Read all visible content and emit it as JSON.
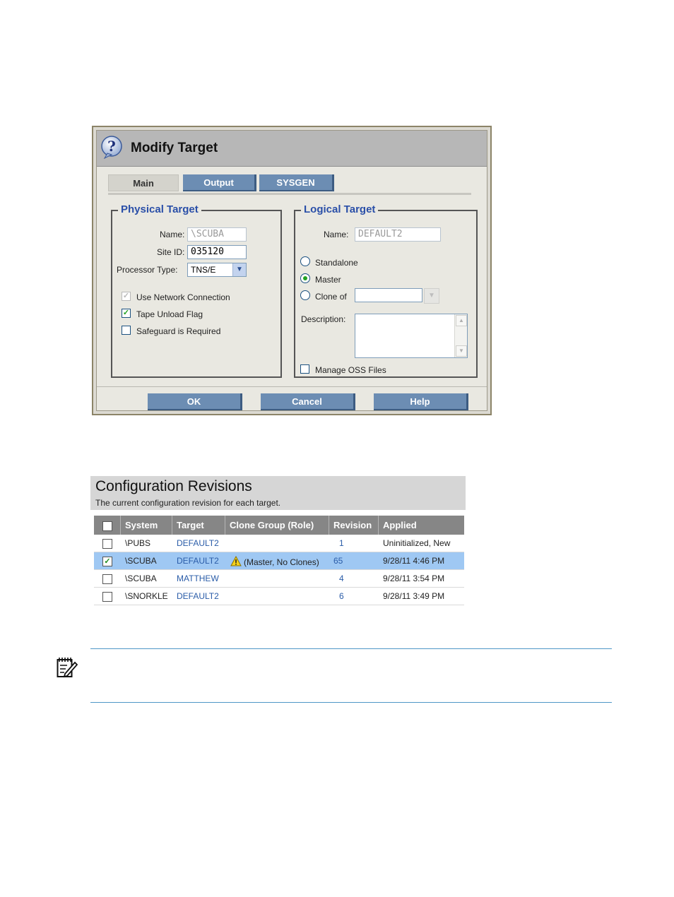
{
  "dialog": {
    "title": "Modify Target",
    "tabs": [
      {
        "label": "Main",
        "active": true
      },
      {
        "label": "Output",
        "active": false
      },
      {
        "label": "SYSGEN",
        "active": false
      }
    ],
    "physical": {
      "legend": "Physical Target",
      "name_label": "Name:",
      "name_value": "\\SCUBA",
      "site_label": "Site ID:",
      "site_value": "035120",
      "proc_label": "Processor Type:",
      "proc_value": "TNS/E",
      "checks": [
        {
          "label": "Use Network Connection",
          "checked": true,
          "disabled": true
        },
        {
          "label": "Tape Unload Flag",
          "checked": true,
          "disabled": false
        },
        {
          "label": "Safeguard is Required",
          "checked": false,
          "disabled": false
        }
      ]
    },
    "logical": {
      "legend": "Logical Target",
      "name_label": "Name:",
      "name_value": "DEFAULT2",
      "radios": [
        {
          "label": "Standalone",
          "selected": false
        },
        {
          "label": "Master",
          "selected": true
        },
        {
          "label": "Clone of",
          "selected": false
        }
      ],
      "clone_value": "",
      "desc_label": "Description:",
      "manage_oss_label": "Manage OSS Files"
    },
    "buttons": {
      "ok": "OK",
      "cancel": "Cancel",
      "help": "Help"
    }
  },
  "revisions": {
    "title": "Configuration Revisions",
    "subtitle": "The current configuration revision for each target.",
    "columns": [
      "System",
      "Target",
      "Clone Group (Role)",
      "Revision",
      "Applied"
    ],
    "rows": [
      {
        "checked": false,
        "selected": false,
        "system": "\\PUBS",
        "target": "DEFAULT2",
        "clone_group": "",
        "revision": "1",
        "applied": "Uninitialized, New"
      },
      {
        "checked": true,
        "selected": true,
        "system": "\\SCUBA",
        "target": "DEFAULT2",
        "clone_group": "(Master, No Clones)",
        "revision": "65",
        "applied": "9/28/11 4:46 PM"
      },
      {
        "checked": false,
        "selected": false,
        "system": "\\SCUBA",
        "target": "MATTHEW",
        "clone_group": "",
        "revision": "4",
        "applied": "9/28/11 3:54 PM"
      },
      {
        "checked": false,
        "selected": false,
        "system": "\\SNORKLE",
        "target": "DEFAULT2",
        "clone_group": "",
        "revision": "6",
        "applied": "9/28/11 3:49 PM"
      }
    ]
  },
  "colors": {
    "accent_blue": "#2a4fa8",
    "button_blue": "#6c8db3",
    "selected_row": "#9fc8f3"
  },
  "icons": {
    "dialog": "help-question-icon",
    "warning": "warning-icon",
    "note": "note-pencil-icon"
  }
}
